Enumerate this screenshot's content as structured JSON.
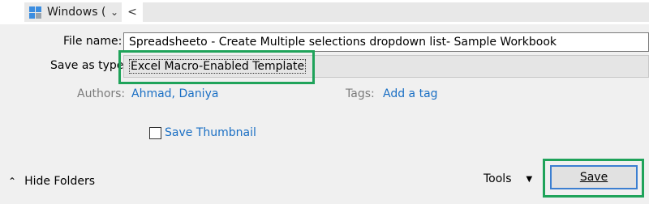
{
  "nav": {
    "tree_item_label": "Windows (",
    "expand_icon": "chevron-down-icon",
    "scroll_icon": "chevron-left-icon",
    "drive_icon": "windows-drive-icon"
  },
  "form": {
    "file_name_label": "File name:",
    "file_name_value": "Spreadsheeto - Create Multiple selections dropdown list- Sample Workbook",
    "save_as_type_label": "Save as type:",
    "save_as_type_value": "Excel Macro-Enabled Template",
    "authors_label": "Authors:",
    "authors_value": "Ahmad, Daniya",
    "tags_label": "Tags:",
    "tags_value": "Add a tag",
    "save_thumbnail_label": "Save Thumbnail",
    "save_thumbnail_checked": false
  },
  "footer": {
    "hide_folders_label": "Hide Folders",
    "tools_label": "Tools",
    "save_label": "Save"
  },
  "colors": {
    "highlight": "#1fa35a",
    "link": "#1a6fc4",
    "save_border": "#3c7fd1"
  }
}
